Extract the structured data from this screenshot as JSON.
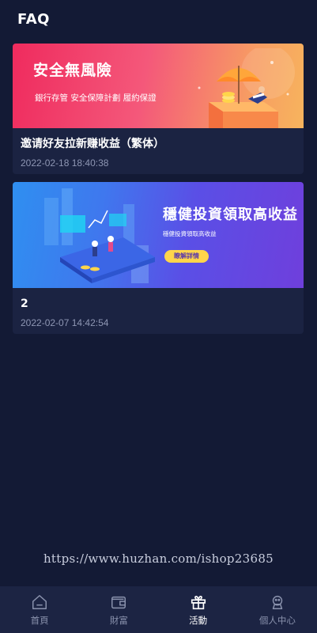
{
  "header": {
    "title": "FAQ"
  },
  "articles": [
    {
      "banner": {
        "headline": "安全無風險",
        "subline": "銀行存管 安全保障計劃 履約保證"
      },
      "title": "邀请好友拉新赚收益（繁体）",
      "date": "2022-02-18 18:40:38"
    },
    {
      "banner": {
        "headline": "穩健投資領取高收益",
        "subline": "穩健投資領取高收益",
        "button": "瞭解詳情"
      },
      "title": "2",
      "date": "2022-02-07 14:42:54"
    }
  ],
  "watermark": "https://www.huzhan.com/ishop23685",
  "tabbar": {
    "items": [
      {
        "label": "首頁",
        "icon": "home-icon"
      },
      {
        "label": "財富",
        "icon": "wallet-icon"
      },
      {
        "label": "活動",
        "icon": "gift-icon",
        "active": true
      },
      {
        "label": "個人中心",
        "icon": "user-icon"
      }
    ]
  },
  "colors": {
    "background": "#131a35",
    "card": "#1b2342",
    "tabbar": "#1c2443",
    "active": "#ffffff",
    "inactive": "#8a92ad"
  }
}
